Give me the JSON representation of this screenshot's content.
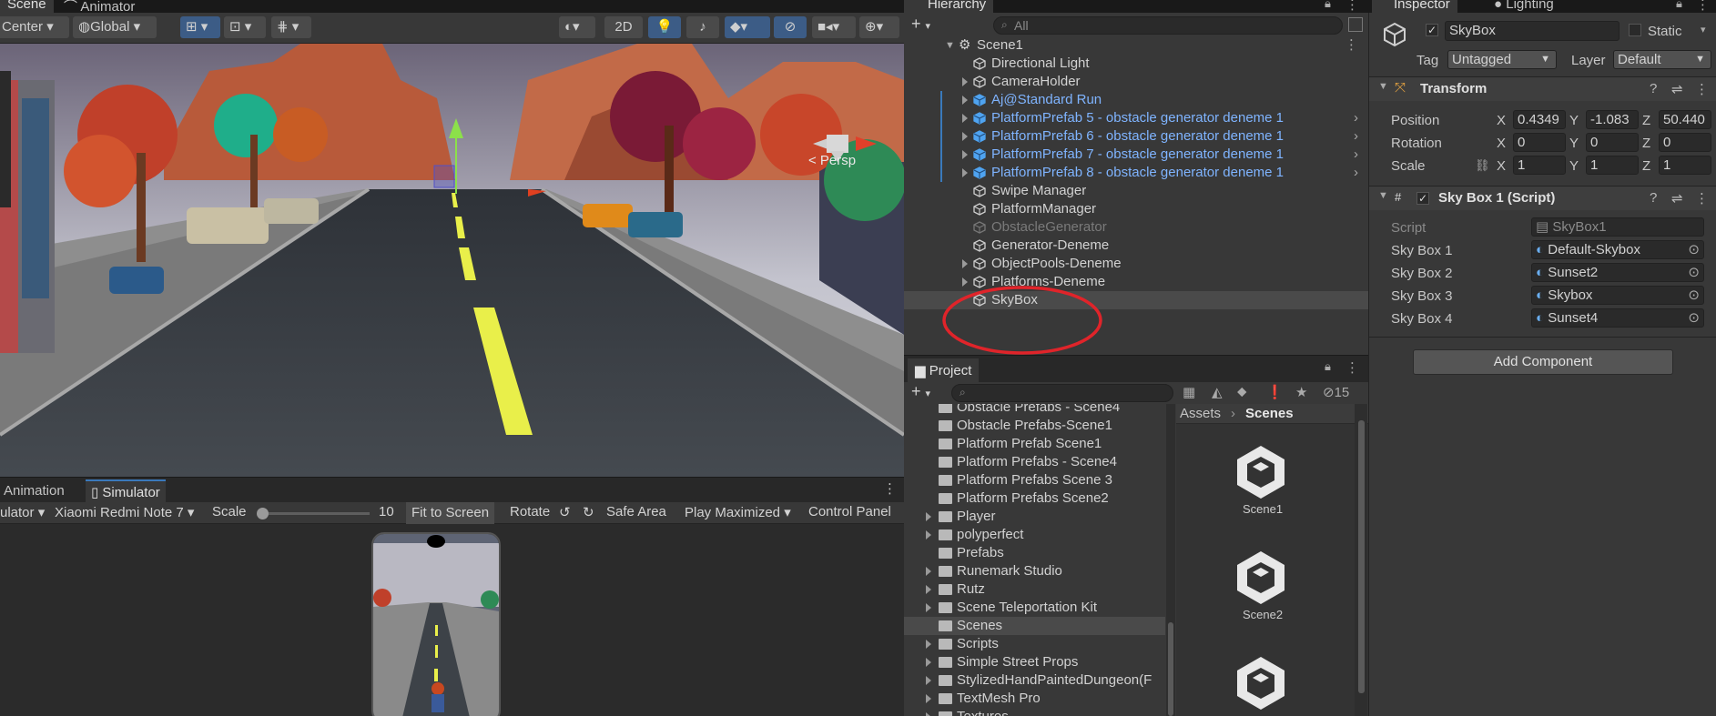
{
  "scene_tabs": [
    "Scene",
    "Animator"
  ],
  "scene_toolbar": {
    "pivot": "Center",
    "space": "Global",
    "mode_2d": "2D"
  },
  "scene_view": {
    "persp_label": "< Persp"
  },
  "game_tabs": [
    "Animation",
    "Simulator"
  ],
  "simulator_bar": {
    "mode": "ulator",
    "device": "Xiaomi Redmi Note 7",
    "scale_label": "Scale",
    "scale_value": "10",
    "fit_to_screen": "Fit to Screen",
    "rotate": "Rotate",
    "safe_area": "Safe Area",
    "play_maximized": "Play Maximized",
    "control_panel": "Control Panel"
  },
  "hierarchy": {
    "tab": "Hierarchy",
    "search_placeholder": "All",
    "scene": "Scene1",
    "items": [
      {
        "label": "Directional Light",
        "style": "normal",
        "arrow": false
      },
      {
        "label": "CameraHolder",
        "style": "normal",
        "arrow": true
      },
      {
        "label": "Aj@Standard Run",
        "style": "blue",
        "arrow": true
      },
      {
        "label": "PlatformPrefab 5 - obstacle generator deneme 1",
        "style": "blue",
        "arrow": true
      },
      {
        "label": "PlatformPrefab 6 - obstacle generator deneme 1",
        "style": "blue",
        "arrow": true
      },
      {
        "label": "PlatformPrefab 7 - obstacle generator deneme 1",
        "style": "blue",
        "arrow": true
      },
      {
        "label": "PlatformPrefab 8 - obstacle generator deneme 1",
        "style": "blue",
        "arrow": true
      },
      {
        "label": "Swipe Manager",
        "style": "normal",
        "arrow": false
      },
      {
        "label": "PlatformManager",
        "style": "normal",
        "arrow": false
      },
      {
        "label": "ObstacleGenerator",
        "style": "dim",
        "arrow": false
      },
      {
        "label": "Generator-Deneme",
        "style": "normal",
        "arrow": false
      },
      {
        "label": "ObjectPools-Deneme",
        "style": "normal",
        "arrow": true
      },
      {
        "label": "Platforms-Deneme",
        "style": "normal",
        "arrow": true
      },
      {
        "label": "SkyBox",
        "style": "normal",
        "arrow": false
      }
    ]
  },
  "project": {
    "tab": "Project",
    "hidden_count": "15",
    "breadcrumb": [
      "Assets",
      "Scenes"
    ],
    "folders": [
      {
        "label": "Obstacle Prefabs - Scene4",
        "arrow": false
      },
      {
        "label": "Obstacle Prefabs-Scene1",
        "arrow": false
      },
      {
        "label": "Platform Prefab Scene1",
        "arrow": false
      },
      {
        "label": "Platform Prefabs - Scene4",
        "arrow": false
      },
      {
        "label": "Platform Prefabs Scene 3",
        "arrow": false
      },
      {
        "label": "Platform Prefabs Scene2",
        "arrow": false
      },
      {
        "label": "Player",
        "arrow": true
      },
      {
        "label": "polyperfect",
        "arrow": true
      },
      {
        "label": "Prefabs",
        "arrow": false
      },
      {
        "label": "Runemark Studio",
        "arrow": true
      },
      {
        "label": "Rutz",
        "arrow": true
      },
      {
        "label": "Scene Teleportation Kit",
        "arrow": true
      },
      {
        "label": "Scenes",
        "arrow": false
      },
      {
        "label": "Scripts",
        "arrow": true
      },
      {
        "label": "Simple Street Props",
        "arrow": true
      },
      {
        "label": "StylizedHandPaintedDungeon(F",
        "arrow": true
      },
      {
        "label": "TextMesh Pro",
        "arrow": true
      },
      {
        "label": "Textures",
        "arrow": true
      }
    ],
    "assets": [
      "Scene1",
      "Scene2"
    ]
  },
  "inspector": {
    "tabs": [
      "Inspector",
      "Lighting"
    ],
    "object_name": "SkyBox",
    "static_label": "Static",
    "tag_label": "Tag",
    "tag_value": "Untagged",
    "layer_label": "Layer",
    "layer_value": "Default",
    "transform": {
      "title": "Transform",
      "position_label": "Position",
      "rotation_label": "Rotation",
      "scale_label": "Scale",
      "position": [
        "0.4349",
        "-1.083",
        "50.440"
      ],
      "rotation": [
        "0",
        "0",
        "0"
      ],
      "scale": [
        "1",
        "1",
        "1"
      ]
    },
    "script_component": {
      "title": "Sky Box 1 (Script)",
      "script_label": "Script",
      "script_value": "SkyBox1",
      "fields": [
        {
          "label": "Sky Box 1",
          "value": "Default-Skybox"
        },
        {
          "label": "Sky Box 2",
          "value": "Sunset2"
        },
        {
          "label": "Sky Box 3",
          "value": "Skybox"
        },
        {
          "label": "Sky Box 4",
          "value": "Sunset4"
        }
      ]
    },
    "add_component": "Add Component"
  },
  "colors": {
    "highlight_circle": "#e0242a",
    "prefab_blue": "#7fb4ff",
    "road": "#3b4046",
    "lane_mark": "#e9ef4a"
  }
}
